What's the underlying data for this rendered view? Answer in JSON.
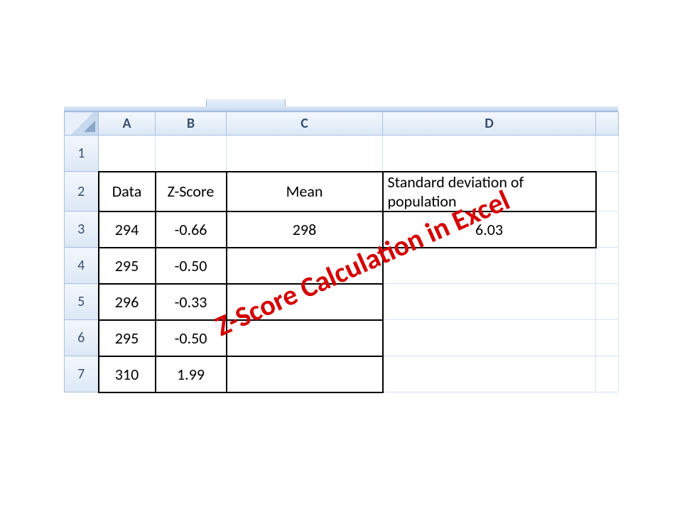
{
  "columns": {
    "A": "A",
    "B": "B",
    "C": "C",
    "D": "D"
  },
  "rows": {
    "1": "1",
    "2": "2",
    "3": "3",
    "4": "4",
    "5": "5",
    "6": "6",
    "7": "7"
  },
  "headers": {
    "data": "Data",
    "zscore": "Z-Score",
    "mean": "Mean",
    "stdev": "Standard deviation of population"
  },
  "values": {
    "data": [
      "294",
      "295",
      "296",
      "295",
      "310"
    ],
    "zscore": [
      "-0.66",
      "-0.50",
      "-0.33",
      "-0.50",
      "1.99"
    ],
    "mean": "298",
    "stdev": "6.03"
  },
  "watermark": "Z-Score Calculation in Excel"
}
